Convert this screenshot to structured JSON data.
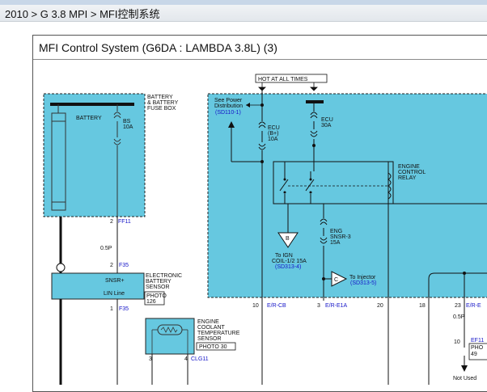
{
  "breadcrumb": {
    "text": "2010 > G 3.8 MPI > MFI控制系统"
  },
  "panel": {
    "title": "MFI Control System (G6DA : LAMBDA 3.8L) (3)"
  },
  "diagram": {
    "battery_fusebox_label": [
      "BATTERY",
      "& BATTERY",
      "FUSE BOX"
    ],
    "battery_label": "BATTERY",
    "fuse_bs": [
      "BS",
      "10A"
    ],
    "hot_at_all_times": "HOT AT ALL TIMES",
    "see_power_dist": [
      "See Power",
      "Distribution"
    ],
    "see_power_ref": "(SD110-1)",
    "fuse_ecu_b": [
      "ECU",
      "(B+)",
      "10A"
    ],
    "fuse_ecu_30": [
      "ECU",
      "30A"
    ],
    "relay_label": [
      "ENGINE",
      "CONTROL",
      "RELAY"
    ],
    "fuse_eng_snsr": [
      "ENG",
      "SNSR-3",
      "15A"
    ],
    "conn_b": "B",
    "to_ign": [
      "To IGN",
      "COIL-1/2 15A"
    ],
    "to_ign_ref": "(SD313-4)",
    "conn_c": "C",
    "to_injector": "To Injector",
    "to_injector_ref": "(SD313-5)",
    "pin_ff11": "2",
    "ff11": "FF11",
    "wire_05p": "0.5P",
    "pin_f35": "2",
    "f35": "F35",
    "sensor_pin_snsr": "SNSR+",
    "sensor_pin_lin": "LIN Line",
    "electronic_battery_sensor": [
      "ELECTRONIC",
      "BATTERY",
      "SENSOR"
    ],
    "photo_126": [
      "PHOTO",
      "126"
    ],
    "pin1_f35": "1",
    "f35_b": "F35",
    "ect_sensor": [
      "ENGINE",
      "COOLANT",
      "TEMPERATURE",
      "SENSOR"
    ],
    "photo_30": "PHOTO 30",
    "pin_3": "3",
    "pin_4": "4",
    "clg11": "CLG11",
    "pin_10": "10",
    "erc_b": "E/R-CB",
    "pin_3b": "3",
    "ere1a": "E/R-E1A",
    "pin_20": "20",
    "pin_18": "18",
    "pin_23": "23",
    "ere_partial": "E/R-E",
    "wire_05p_b": "0.5P",
    "pin_10b": "10",
    "ef11": "EF11",
    "pho_partial": "PHO",
    "num_49": "49",
    "not_used": [
      "Not Used"
    ]
  }
}
